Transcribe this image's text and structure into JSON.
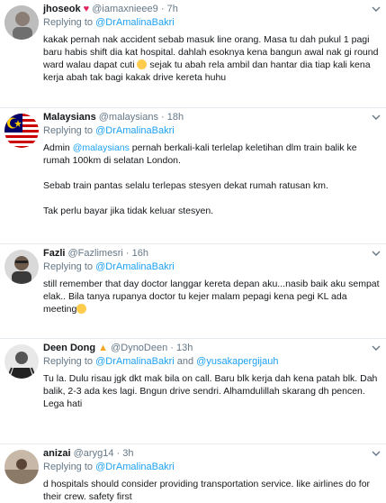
{
  "tweets": [
    {
      "name": "jhoseok",
      "handle": "@iamaxnieee9",
      "time": "7h",
      "replying_prefix": "Replying to",
      "replying_to": "@DrAmalinaBakri",
      "text1": "kakak pernah nak accident sebab masuk line orang. Masa tu dah pukul 1 pagi baru habis shift dia kat hospital. dahlah esoknya kena bangun awal nak gi round ward walau dapat cuti",
      "text2": " sejak tu abah rela ambil dan hantar dia tiap kali kena kerja abah tak bagi kakak drive kereta huhu"
    },
    {
      "name": "Malaysians",
      "handle": "@malaysians",
      "time": "18h",
      "replying_prefix": "Replying to",
      "replying_to": "@DrAmalinaBakri",
      "p1_a": "Admin ",
      "p1_mention": "@malaysians",
      "p1_b": " pernah berkali-kali terlelap keletihan dlm train balik ke rumah 100km di selatan London.",
      "p2": "Sebab train pantas selalu terlepas stesyen dekat rumah ratusan km.",
      "p3": "Tak perlu bayar jika tidak keluar stesyen."
    },
    {
      "name": "Fazli",
      "handle": "@Fazlimesri",
      "time": "16h",
      "replying_prefix": "Replying to",
      "replying_to": "@DrAmalinaBakri",
      "text1": "still remember that day doctor  langgar kereta depan aku...nasib baik aku sempat elak.. Bila tanya rupanya doctor tu kejer malam pepagi kena pegi KL ada meeting"
    },
    {
      "name": "Deen Dong",
      "handle": "@DynoDeen",
      "time": "13h",
      "replying_prefix": "Replying to",
      "replying_to": "@DrAmalinaBakri",
      "replying_and": "and",
      "replying_to2": "@yusakapergijauh",
      "text1": "Tu la. Dulu risau jgk dkt mak bila on call. Baru blk kerja dah kena patah blk. Dah balik, 2-3 ada kes lagi. Bngun drive sendri. Alhamdulillah skarang dh pencen. Lega hati"
    },
    {
      "name": "anizai",
      "handle": "@aryg14",
      "time": "3h",
      "replying_prefix": "Replying to",
      "replying_to": "@DrAmalinaBakri",
      "text1": "d hospitals should consider providing transportation service. like airlines do for their crew. safety first"
    }
  ],
  "colors": {
    "link": "#1da1f2",
    "muted": "#657786",
    "text": "#14171a",
    "heart": "#e0245e",
    "divider": "#e6ecf0"
  }
}
